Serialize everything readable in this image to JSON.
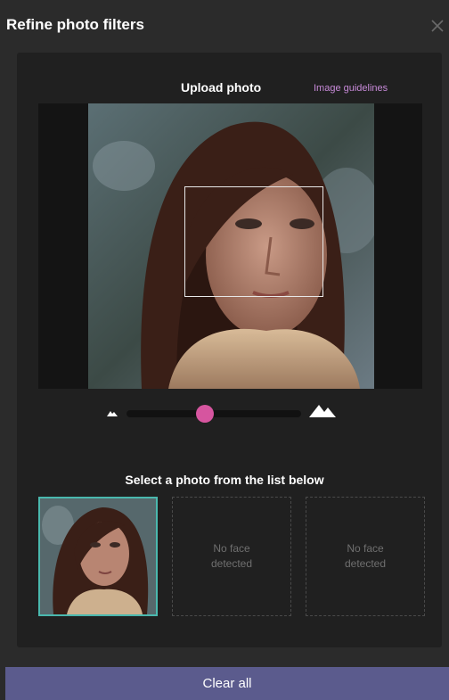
{
  "dialog": {
    "title": "Refine photo filters",
    "close_icon": "close-icon"
  },
  "upload": {
    "label": "Upload photo",
    "guidelines_link": "Image guidelines"
  },
  "zoom": {
    "min_icon": "mountain-small-icon",
    "max_icon": "mountain-large-icon",
    "value": 0.45
  },
  "candidates": {
    "heading": "Select a photo from the list below",
    "items": [
      {
        "selected": true,
        "has_face": true
      },
      {
        "selected": false,
        "has_face": false,
        "text": "No face detected"
      },
      {
        "selected": false,
        "has_face": false,
        "text": "No face detected"
      }
    ]
  },
  "footer": {
    "clear_label": "Clear all"
  },
  "colors": {
    "accent_pink": "#d6559f",
    "link_pink": "#c78ad8",
    "selected_teal": "#4ab8ae",
    "button_purple": "#5b5b8d"
  }
}
